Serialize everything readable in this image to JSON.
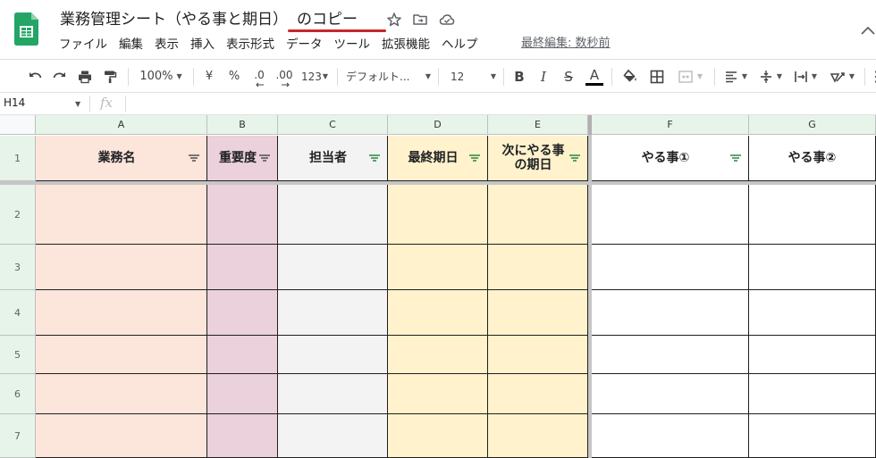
{
  "header": {
    "title_main": "業務管理シート（やる事と期日）",
    "title_suffix": "のコピー",
    "menu": [
      "ファイル",
      "編集",
      "表示",
      "挿入",
      "表示形式",
      "データ",
      "ツール",
      "拡張機能",
      "ヘルプ"
    ],
    "last_edit": "最終編集: 数秒前"
  },
  "toolbar": {
    "zoom": "100%",
    "currency": "¥",
    "percent": "%",
    "dec_decrease": ".0",
    "dec_increase": ".00",
    "number_format": "123",
    "font": "デフォルト...",
    "font_size": "12",
    "bold": "B",
    "italic": "I",
    "strike": "S",
    "text_color_letter": "A"
  },
  "formula_bar": {
    "name_box": "H14",
    "fx": "fx"
  },
  "grid": {
    "columns": [
      "A",
      "B",
      "C",
      "D",
      "E",
      "F",
      "G"
    ],
    "rows": [
      "1",
      "2",
      "3",
      "4",
      "5",
      "6",
      "7"
    ],
    "headers": [
      "業務名",
      "重要度",
      "担当者",
      "最終期日",
      "次にやる事\nの期日",
      "やる事①",
      "やる事②"
    ],
    "column_colors": [
      "#fce5da",
      "#ead1dc",
      "#f3f3f3",
      "#fff2cc",
      "#fff2cc",
      "#ffffff",
      "#ffffff"
    ],
    "accent_green": "#188038"
  }
}
